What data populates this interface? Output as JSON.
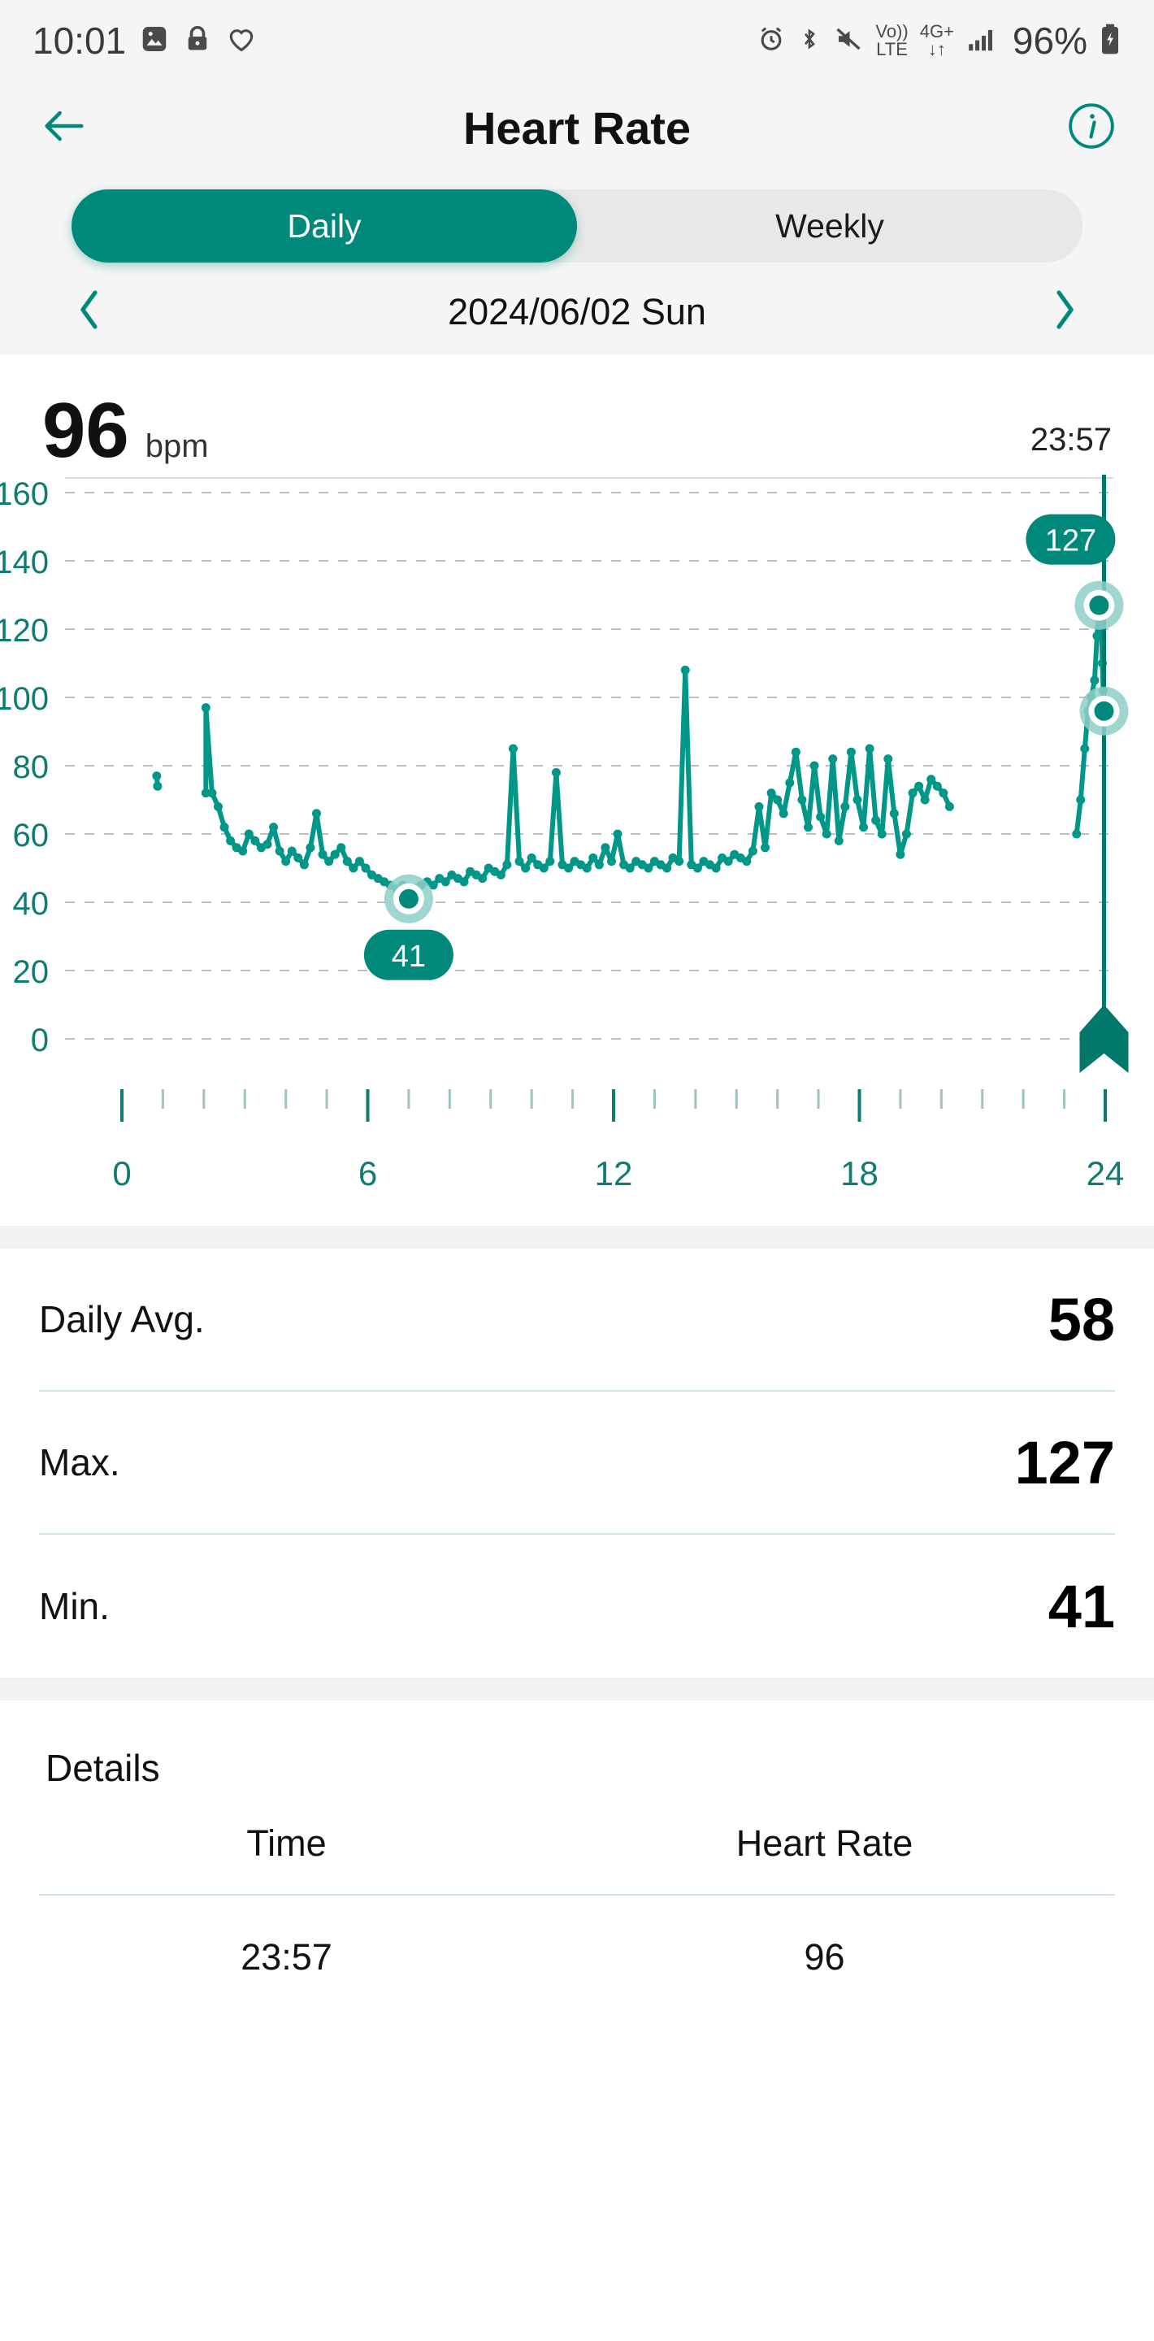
{
  "status_bar": {
    "time": "10:01",
    "left_icons": [
      "image-icon",
      "lock-icon",
      "heart-icon"
    ],
    "right_icons": [
      "alarm-icon",
      "bluetooth-icon",
      "mute-icon",
      "volte-icon",
      "network-4gplus-icon",
      "signal-bars-icon"
    ],
    "battery_percent": "96%",
    "volte_line1": "Vo))",
    "volte_line2": "LTE",
    "net_line1": "4G+",
    "net_line2": "↓↑"
  },
  "header": {
    "title": "Heart Rate",
    "back_icon": "back-arrow-icon",
    "info_icon": "info-icon"
  },
  "tabs": {
    "items": [
      {
        "label": "Daily",
        "active": true
      },
      {
        "label": "Weekly",
        "active": false
      }
    ]
  },
  "date_nav": {
    "prev_icon": "chevron-left-icon",
    "next_icon": "chevron-right-icon",
    "date": "2024/06/02 Sun"
  },
  "summary": {
    "value": "96",
    "unit": "bpm",
    "time": "23:57"
  },
  "stats": {
    "rows": [
      {
        "label": "Daily Avg.",
        "value": "58"
      },
      {
        "label": "Max.",
        "value": "127"
      },
      {
        "label": "Min.",
        "value": "41"
      }
    ]
  },
  "details": {
    "title": "Details",
    "columns": [
      "Time",
      "Heart Rate"
    ],
    "rows": [
      {
        "time": "23:57",
        "heart_rate": "96"
      }
    ]
  },
  "colors": {
    "accent": "#00897b",
    "accent_line": "#009688",
    "accent_dark": "#00796b",
    "ring_halo": "#8fcfc8",
    "grid": "#bdbdbd",
    "page_bg": "#f5f5f5",
    "divider": "#cfe5e2"
  },
  "chart_data": {
    "type": "line",
    "title": "",
    "xlabel": "",
    "ylabel": "",
    "xlim": [
      0,
      24
    ],
    "ylim": [
      0,
      160
    ],
    "xticks": [
      0,
      6,
      12,
      18,
      24
    ],
    "xtick_labels": [
      "0",
      "6",
      "12",
      "18",
      "24"
    ],
    "yticks": [
      0,
      20,
      40,
      60,
      80,
      100,
      120,
      140,
      160
    ],
    "ytick_labels": [
      "0",
      "20",
      "40",
      "60",
      "80",
      "100",
      "120",
      "140",
      "160"
    ],
    "minor_xtick_step": 1,
    "grid": true,
    "grid_style": "dashed-horizontal",
    "legend": "none",
    "series": [
      {
        "name": "Heart Rate",
        "unit": "bpm",
        "x": [
          0.85,
          0.87,
          2.05,
          2.05,
          2.2,
          2.35,
          2.5,
          2.65,
          2.8,
          2.95,
          3.1,
          3.25,
          3.4,
          3.55,
          3.7,
          3.85,
          4.0,
          4.15,
          4.3,
          4.45,
          4.6,
          4.75,
          4.9,
          5.05,
          5.2,
          5.35,
          5.5,
          5.65,
          5.8,
          5.95,
          6.1,
          6.25,
          6.4,
          6.55,
          6.7,
          6.85,
          7.0,
          7.15,
          7.3,
          7.45,
          7.6,
          7.75,
          7.9,
          8.05,
          8.2,
          8.35,
          8.5,
          8.65,
          8.8,
          8.95,
          9.1,
          9.25,
          9.4,
          9.55,
          9.7,
          9.85,
          10.0,
          10.15,
          10.3,
          10.45,
          10.6,
          10.75,
          10.9,
          11.05,
          11.2,
          11.35,
          11.5,
          11.65,
          11.8,
          11.95,
          12.1,
          12.25,
          12.4,
          12.55,
          12.7,
          12.85,
          13.0,
          13.15,
          13.3,
          13.45,
          13.6,
          13.75,
          13.9,
          14.05,
          14.2,
          14.35,
          14.5,
          14.65,
          14.8,
          14.95,
          15.1,
          15.25,
          15.4,
          15.55,
          15.7,
          15.85,
          16.0,
          16.15,
          16.3,
          16.45,
          16.6,
          16.75,
          16.9,
          17.05,
          17.2,
          17.35,
          17.5,
          17.65,
          17.8,
          17.95,
          18.1,
          18.25,
          18.4,
          18.55,
          18.7,
          18.85,
          19.0,
          19.15,
          19.3,
          19.45,
          19.6,
          19.75,
          19.9,
          20.05,
          20.2,
          23.3,
          23.4,
          23.5,
          23.58,
          23.66,
          23.74,
          23.8,
          23.85,
          23.9,
          23.93,
          23.95,
          23.97
        ],
        "y": [
          77,
          74,
          72,
          97,
          72,
          68,
          62,
          58,
          56,
          55,
          60,
          58,
          56,
          57,
          62,
          55,
          52,
          55,
          53,
          51,
          56,
          66,
          54,
          52,
          54,
          56,
          52,
          50,
          52,
          50,
          48,
          47,
          46,
          45,
          44,
          45,
          41,
          44,
          45,
          46,
          45,
          47,
          46,
          48,
          47,
          46,
          49,
          48,
          47,
          50,
          49,
          48,
          51,
          85,
          52,
          50,
          53,
          51,
          50,
          52,
          78,
          51,
          50,
          52,
          51,
          50,
          53,
          51,
          56,
          52,
          60,
          51,
          50,
          52,
          51,
          50,
          52,
          51,
          50,
          53,
          52,
          108,
          51,
          50,
          52,
          51,
          50,
          53,
          52,
          54,
          53,
          52,
          55,
          68,
          56,
          72,
          70,
          66,
          75,
          84,
          70,
          62,
          80,
          65,
          60,
          82,
          58,
          68,
          84,
          70,
          62,
          85,
          64,
          60,
          82,
          66,
          54,
          60,
          72,
          74,
          70,
          76,
          74,
          72,
          68,
          60,
          70,
          85,
          96,
          100,
          105,
          118,
          127,
          124,
          110,
          102,
          96
        ],
        "color": "#009688"
      }
    ],
    "markers": [
      {
        "label": "127",
        "x": 23.85,
        "y": 127,
        "type": "max",
        "badge_position": "left"
      },
      {
        "label": "96",
        "x": 23.97,
        "y": 96,
        "type": "current",
        "badge_position": "none"
      },
      {
        "label": "41",
        "x": 7.0,
        "y": 41,
        "type": "min",
        "badge_position": "below"
      }
    ],
    "cursor": {
      "x": 23.97,
      "visible": true,
      "marker_icon": "cursor-flag-icon"
    }
  }
}
